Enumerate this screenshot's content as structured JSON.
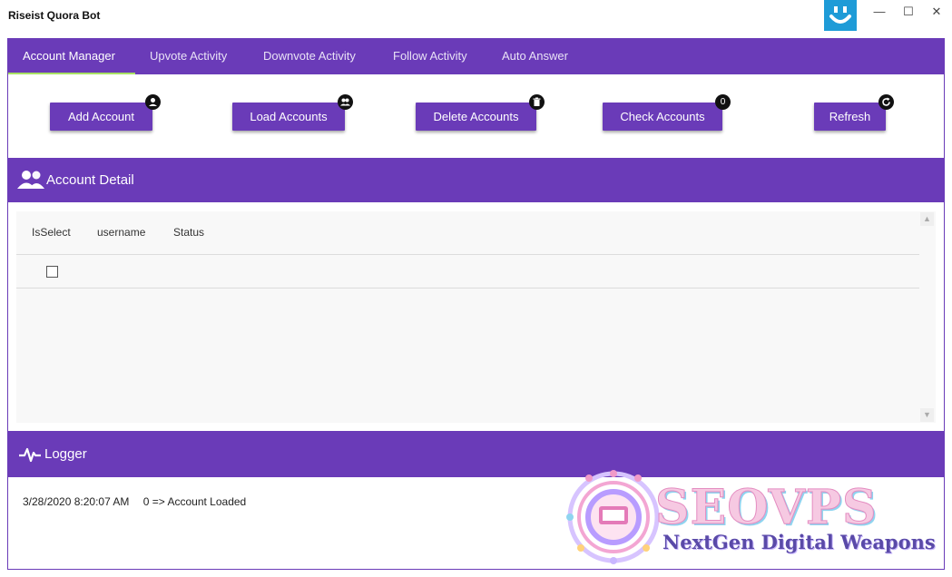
{
  "window": {
    "title": "Riseist Quora Bot",
    "controls": [
      "minimize-icon",
      "maximize-icon",
      "close-icon"
    ],
    "minimize_glyph": "—",
    "maximize_glyph": "☐",
    "close_glyph": "✕"
  },
  "tabs": [
    {
      "label": "Account Manager",
      "active": true
    },
    {
      "label": "Upvote Activity",
      "active": false
    },
    {
      "label": "Downvote Activity",
      "active": false
    },
    {
      "label": "Follow Activity",
      "active": false
    },
    {
      "label": "Auto Answer",
      "active": false
    }
  ],
  "actions": [
    {
      "label": "Add Account",
      "badge_icon": "person-icon"
    },
    {
      "label": "Load Accounts",
      "badge_icon": "people-icon"
    },
    {
      "label": "Delete Accounts",
      "badge_icon": "trash-icon"
    },
    {
      "label": "Check Accounts",
      "badge_text": "0"
    },
    {
      "label": "Refresh",
      "badge_icon": "refresh-icon"
    }
  ],
  "account_detail": {
    "title": "Account Detail",
    "icon": "people-icon",
    "columns": [
      "IsSelect",
      "username",
      "Status"
    ],
    "rows": [
      {
        "selected": false,
        "username": "",
        "status": ""
      }
    ]
  },
  "logger": {
    "title": "Logger",
    "icon": "pulse-icon",
    "entries": [
      {
        "timestamp": "3/28/2020 8:20:07 AM",
        "message": "0 => Account Loaded"
      }
    ]
  },
  "watermark": {
    "title": "SEOVPS",
    "subtitle": "NextGen Digital Weapons"
  },
  "colors": {
    "accent": "#6a3bb8",
    "tab_underline": "#a8e063",
    "smiley_bg": "#1e9bd7"
  }
}
